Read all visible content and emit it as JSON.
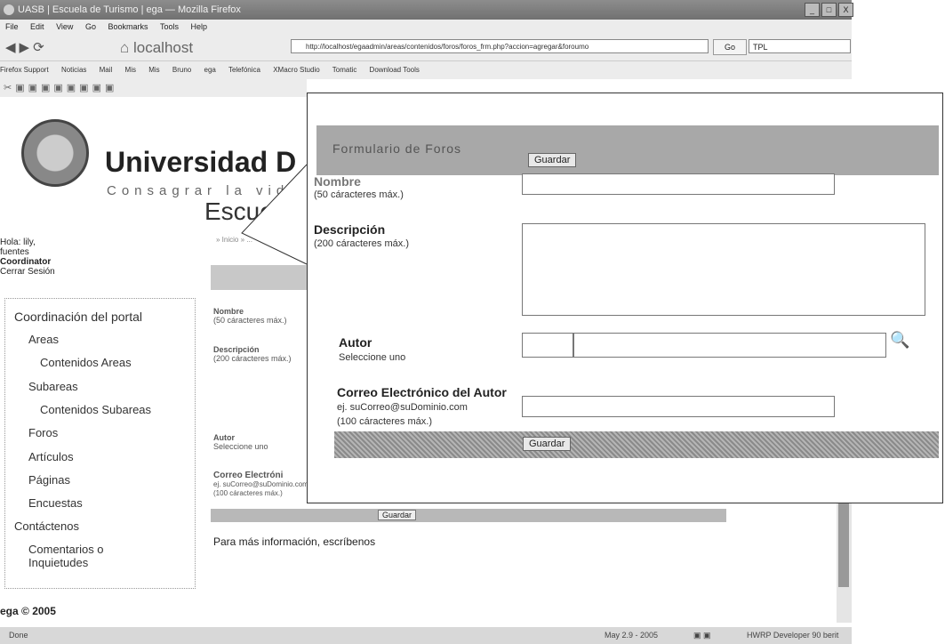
{
  "window": {
    "title": "UASB | Escuela de Turismo | ega — Mozilla Firefox",
    "controls": [
      "_",
      "□",
      "X"
    ]
  },
  "menu": [
    "File",
    "Edit",
    "View",
    "Go",
    "Bookmarks",
    "Tools",
    "Help"
  ],
  "nav": {
    "home_label": "localhost",
    "url": "http://localhost/egaadmin/areas/contenidos/foros/foros_frm.php?accion=agregar&foroumo",
    "go_label": "Go",
    "search_value": "TPL"
  },
  "bookmarks": [
    "Firefox Support",
    "Noticias",
    "Mail",
    "Mis",
    "Mis",
    "Bruno",
    "ega",
    "Telefónica",
    "XMacro Studio",
    "Tomatic",
    "Download Tools"
  ],
  "page": {
    "university": "Universidad D",
    "motto": "Consagrar la vid",
    "school": "Escue",
    "greeting_hola": "Hola:",
    "greeting_name": "lily,",
    "greeting_surname": "fuentes",
    "greeting_role": "Coordinator",
    "logout": "Cerrar Sesión",
    "breadcrumb": "» Inicio » ...",
    "sidebar": [
      "Coordinación del portal",
      "Areas",
      "Contenidos Areas",
      "Subareas",
      "Contenidos Subareas",
      "Foros",
      "Artículos",
      "Páginas",
      "Encuestas",
      "Contáctenos",
      "Comentarios o",
      "Inquietudes"
    ],
    "bg_form": {
      "nombre": "Nombre",
      "nombre_hint": "(50 cáracteres máx.)",
      "descripcion": "Descripción",
      "descripcion_hint": "(200 cáracteres máx.)",
      "autor": "Autor",
      "autor_hint": "Seleccione uno",
      "correo": "Correo Electróni",
      "correo_hint1": "ej. suCorreo@suDominio.com",
      "correo_hint2": "(100 cáracteres máx.)",
      "guardar": "Guardar"
    },
    "info": "Para más información, escríbenos",
    "footer": "ega © 2005"
  },
  "zoom": {
    "title": "Formulario de Foros",
    "guardar_top": "Guardar",
    "nombre_label": "Nombre",
    "nombre_hint": "(50 cáracteres máx.)",
    "descripcion_label": "Descripción",
    "descripcion_hint": "(200 cáracteres máx.)",
    "autor_label": "Autor",
    "autor_hint": "Seleccione uno",
    "correo_label": "Correo Electrónico del Autor",
    "correo_hint1": "ej. suCorreo@suDominio.com",
    "correo_hint2": "(100 cáracteres máx.)",
    "guardar_bottom": "Guardar"
  },
  "status": {
    "done": "Done",
    "date": "May 2.9 - 2005",
    "developer": "HWRP Developer  90 berit"
  }
}
